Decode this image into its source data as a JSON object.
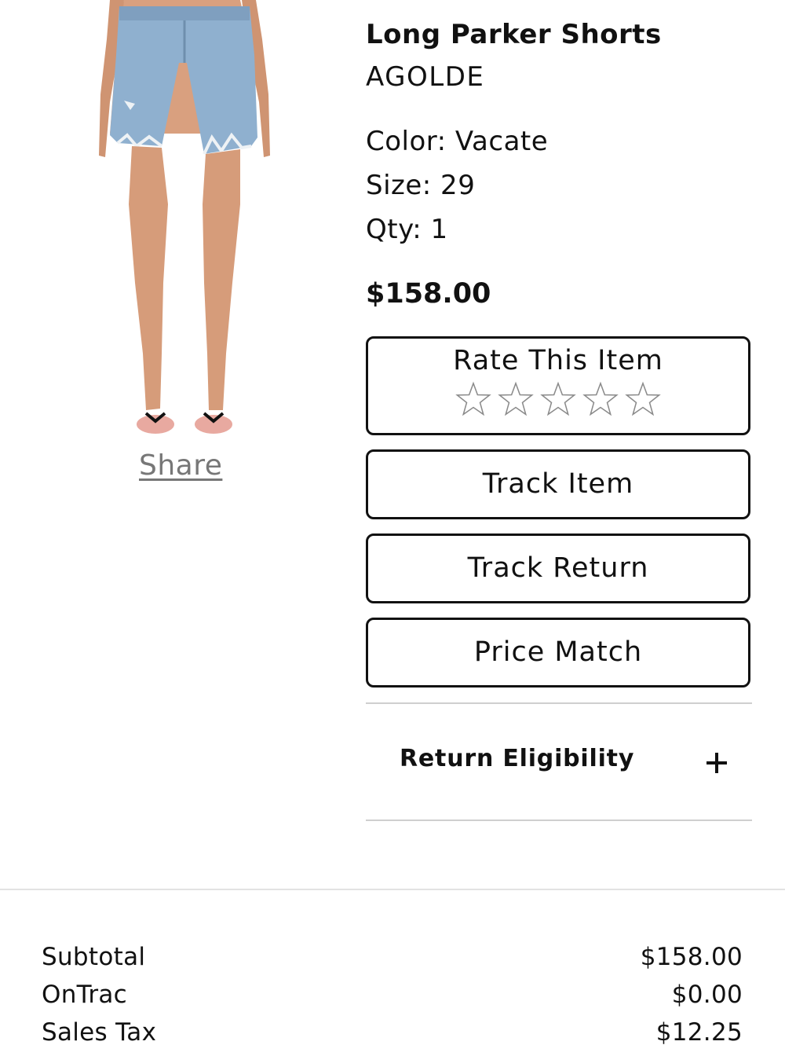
{
  "product": {
    "name": "Long Parker Shorts",
    "brand": "AGOLDE",
    "color": "Color: Vacate",
    "size": "Size: 29",
    "qty": "Qty: 1",
    "price": "$158.00",
    "share_label": "Share",
    "image_icon": "denim-shorts-model-photo"
  },
  "actions": {
    "rate_title": "Rate This Item",
    "rating": 0,
    "rating_max": 5,
    "track_item": "Track Item",
    "track_return": "Track Return",
    "price_match": "Price Match"
  },
  "return_eligibility": {
    "label": "Return Eligibility",
    "toggle_icon": "plus-icon"
  },
  "summary": {
    "rows": [
      {
        "label": "Subtotal",
        "value": "$158.00"
      },
      {
        "label": "OnTrac",
        "value": "$0.00"
      },
      {
        "label": "Sales Tax",
        "value": "$12.25"
      }
    ]
  }
}
